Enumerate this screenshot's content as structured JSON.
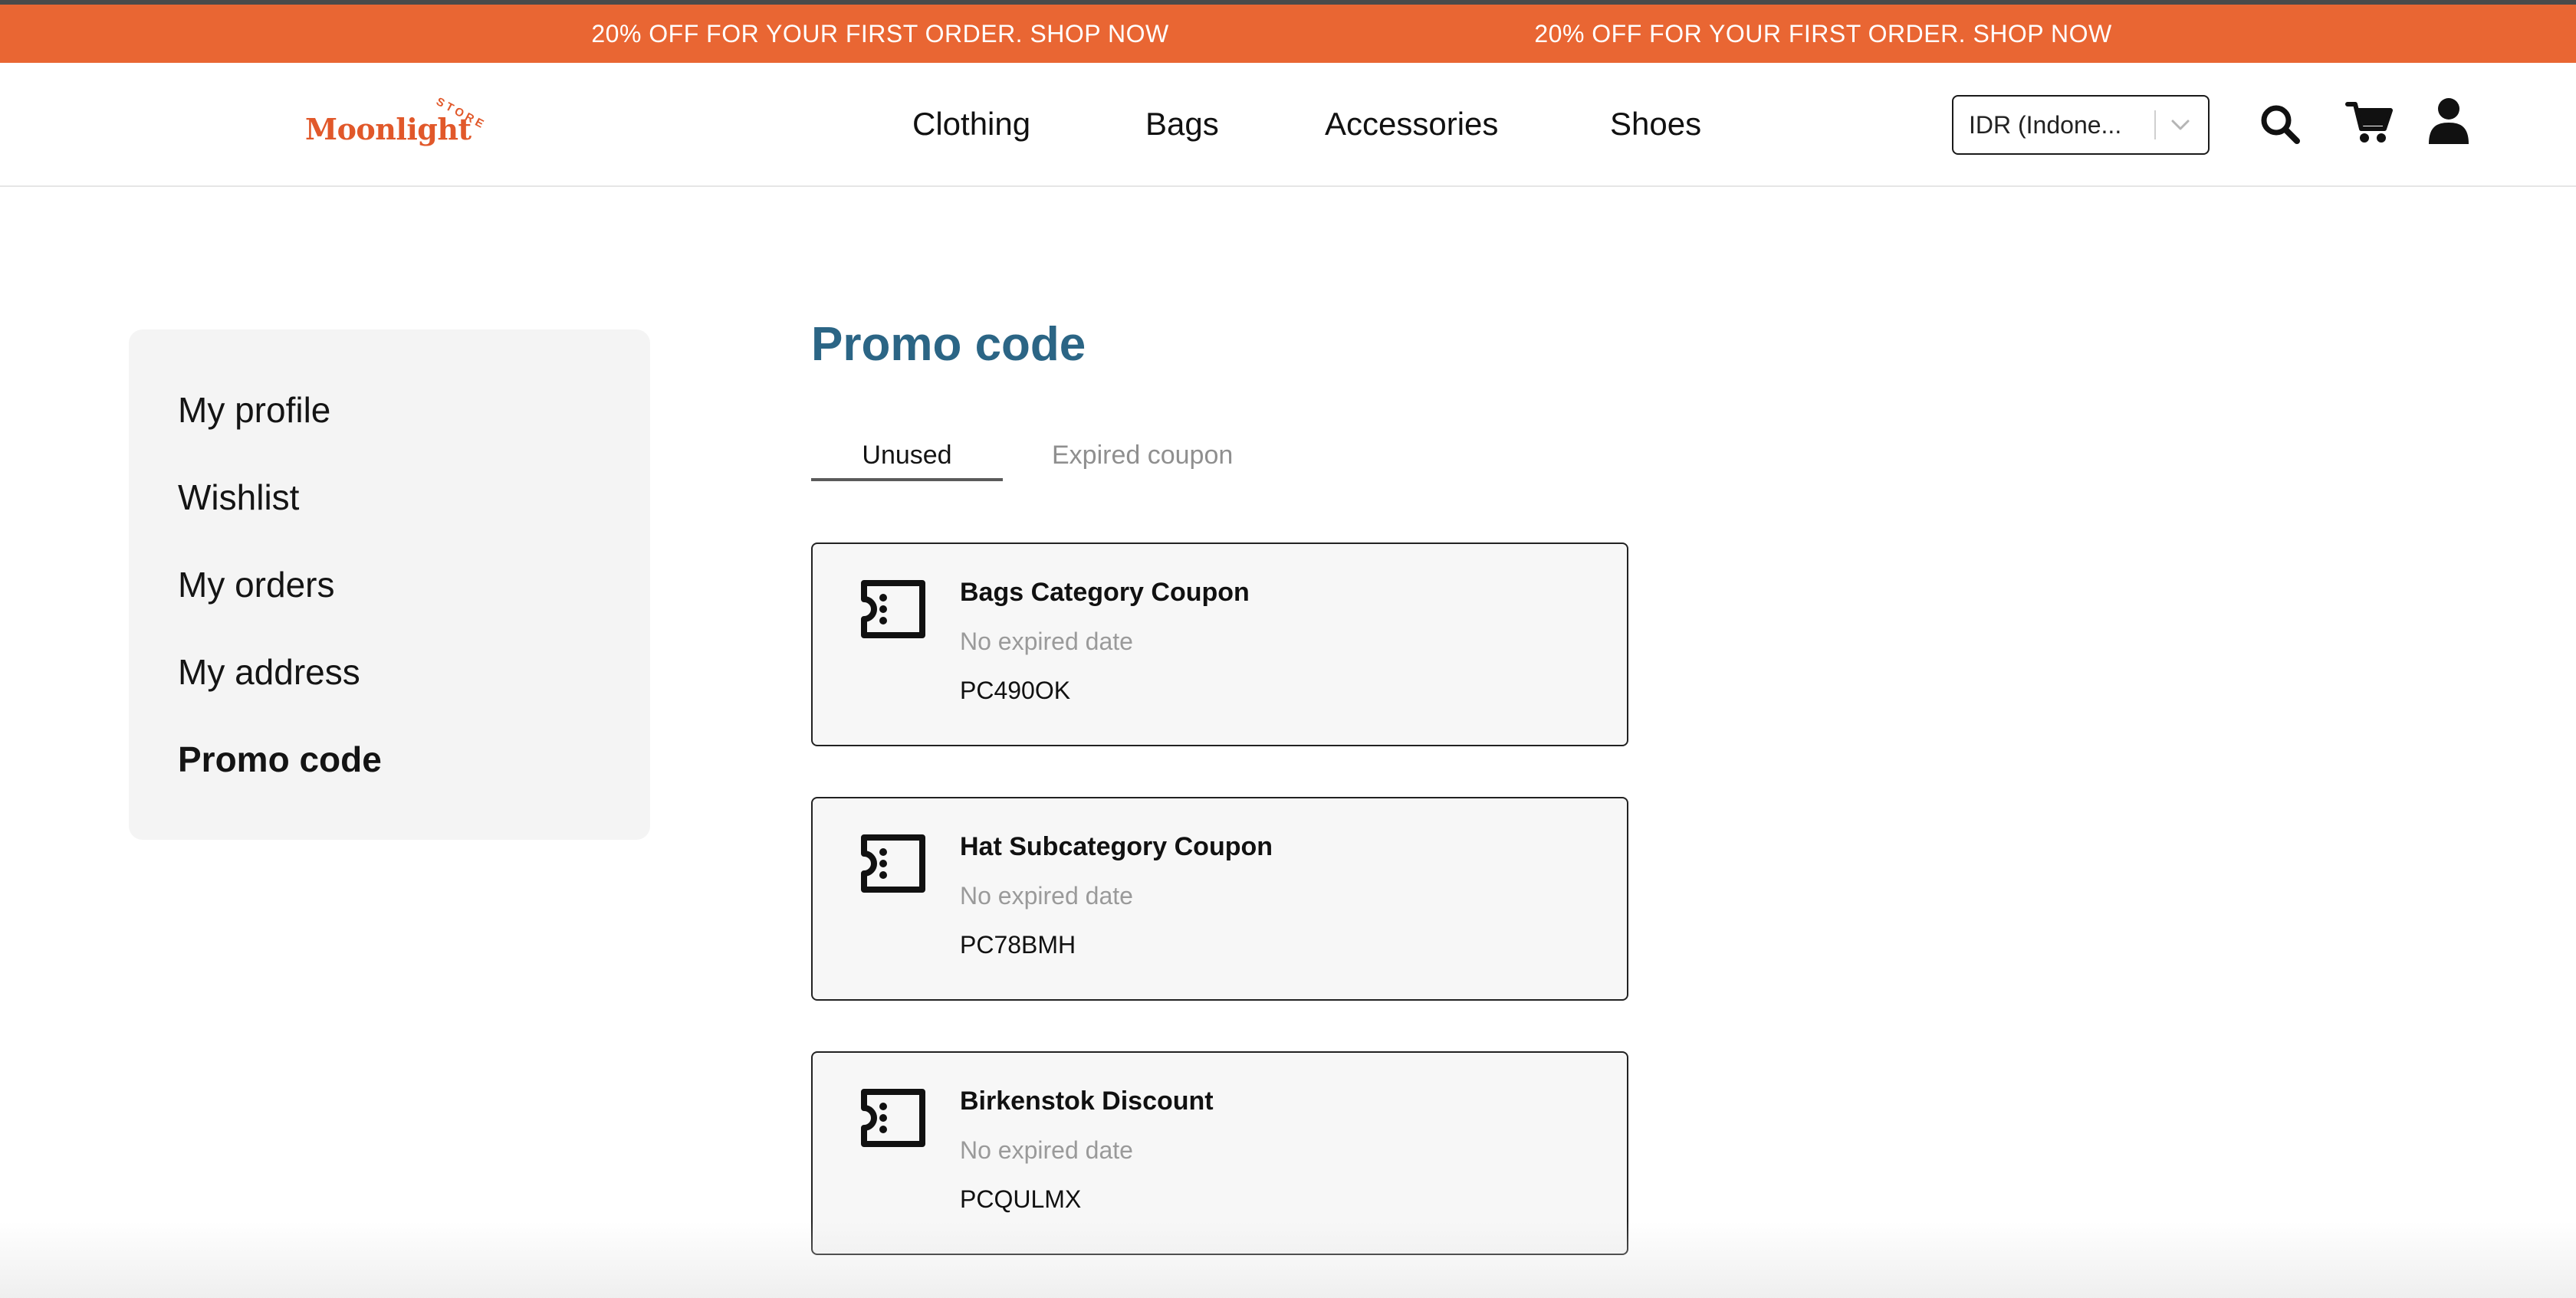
{
  "banner": {
    "messages": [
      "20% OFF FOR YOUR FIRST ORDER. SHOP NOW",
      "20% OFF FOR YOUR FIRST ORDER. SHOP NOW"
    ],
    "background": "#e96633"
  },
  "header": {
    "logo": {
      "word": "Moonlight",
      "tag": "STORE"
    },
    "nav": [
      "Clothing",
      "Bags",
      "Accessories",
      "Shoes"
    ],
    "currency": {
      "value": "IDR (Indone..."
    },
    "icons": [
      "search-icon",
      "cart-icon",
      "user-icon"
    ]
  },
  "sidebar": {
    "items": [
      {
        "label": "My profile",
        "active": false
      },
      {
        "label": "Wishlist",
        "active": false
      },
      {
        "label": "My orders",
        "active": false
      },
      {
        "label": "My address",
        "active": false
      },
      {
        "label": "Promo code",
        "active": true
      }
    ]
  },
  "main": {
    "title": "Promo code",
    "tabs": [
      {
        "label": "Unused",
        "active": true
      },
      {
        "label": "Expired coupon",
        "active": false
      }
    ],
    "coupons": [
      {
        "name": "Bags Category Coupon",
        "expiry": "No expired date",
        "code": "PC490OK"
      },
      {
        "name": "Hat Subcategory Coupon",
        "expiry": "No expired date",
        "code": "PC78BMH"
      },
      {
        "name": "Birkenstok Discount",
        "expiry": "No expired date",
        "code": "PCQULMX"
      }
    ]
  },
  "colors": {
    "accent": "#e96633",
    "title": "#2b6585",
    "sidebar_bg": "#f4f4f4",
    "muted_text": "#9a9a9a"
  }
}
